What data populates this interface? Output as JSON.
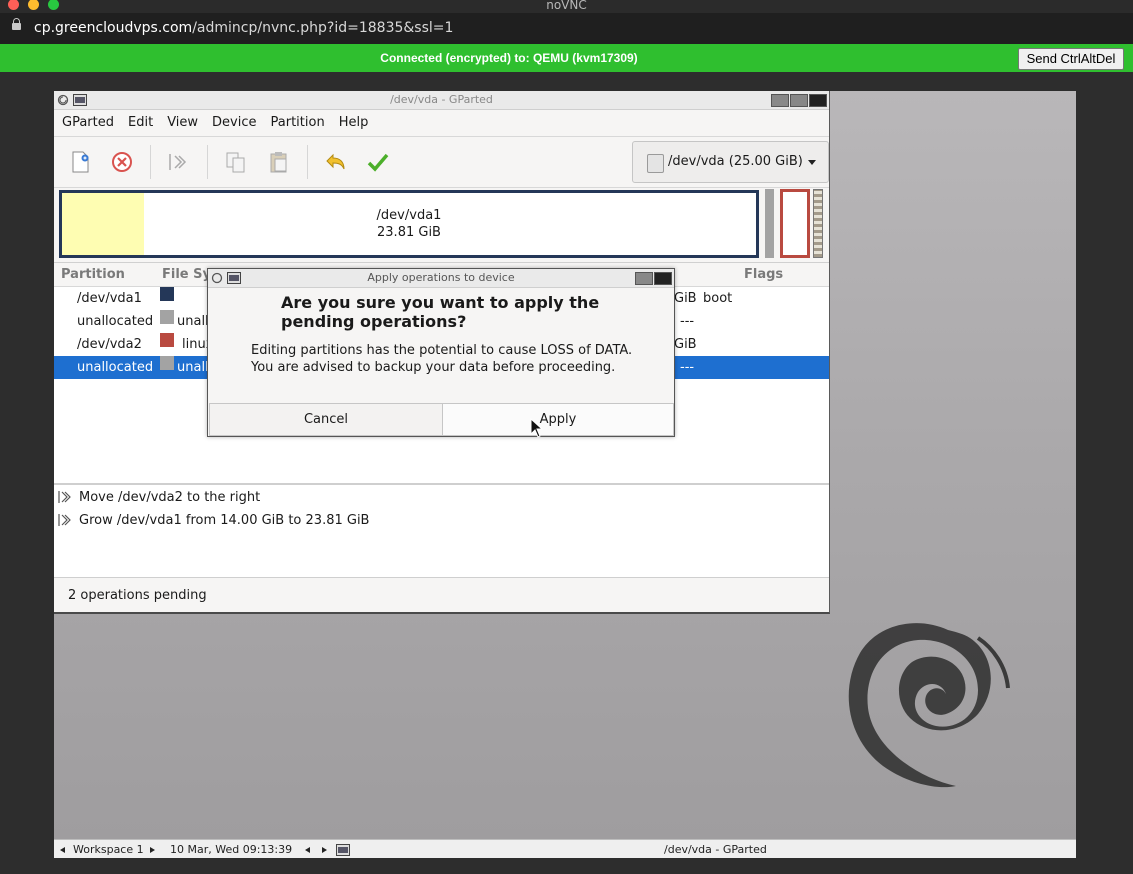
{
  "browser": {
    "window_title": "noVNC",
    "url_host": "cp.greencloudvps.com",
    "url_path": "/admincp/nvnc.php?id=18835&ssl=1"
  },
  "vnc": {
    "status": "Connected (encrypted) to: QEMU (kvm17309)",
    "send_cad_label": "Send CtrlAltDel",
    "status_color": "#2fbf2f"
  },
  "gparted": {
    "title": "/dev/vda - GParted",
    "menu": [
      "GParted",
      "Edit",
      "View",
      "Device",
      "Partition",
      "Help"
    ],
    "device_selector": "/dev/vda (25.00 GiB)",
    "diskmap": {
      "vda1_name": "/dev/vda1",
      "vda1_size": "23.81 GiB"
    },
    "table": {
      "headers": {
        "partition": "Partition",
        "filesystem": "File System",
        "flags": "Flags"
      },
      "rows": [
        {
          "partition": "/dev/vda1",
          "fs": "",
          "tail": "GiB",
          "flags": "boot",
          "color": "#243758"
        },
        {
          "partition": "unallocated",
          "fs": "unallocated",
          "tail": "---",
          "flags": "",
          "color": "#a3a3a3"
        },
        {
          "partition": "/dev/vda2",
          "fs": "linux-swap",
          "tail": "GiB",
          "flags": "",
          "color": "#b94a40"
        },
        {
          "partition": "unallocated",
          "fs": "unallocated",
          "tail": "---",
          "flags": "",
          "color": "#a3a3a3"
        }
      ]
    },
    "operations": [
      "Move /dev/vda2 to the right",
      "Grow /dev/vda1 from 14.00 GiB to 23.81 GiB"
    ],
    "status": "2 operations pending"
  },
  "dialog": {
    "title": "Apply operations to device",
    "heading": "Are you sure you want to apply the pending operations?",
    "body_line1": "Editing partitions has the potential to cause LOSS of DATA.",
    "body_line2": "You are advised to backup your data before proceeding.",
    "cancel_label": "Cancel",
    "apply_label": "Apply"
  },
  "taskbar": {
    "workspace": "Workspace 1",
    "datetime": "10 Mar, Wed 09:13:39",
    "active_window": "/dev/vda - GParted"
  }
}
